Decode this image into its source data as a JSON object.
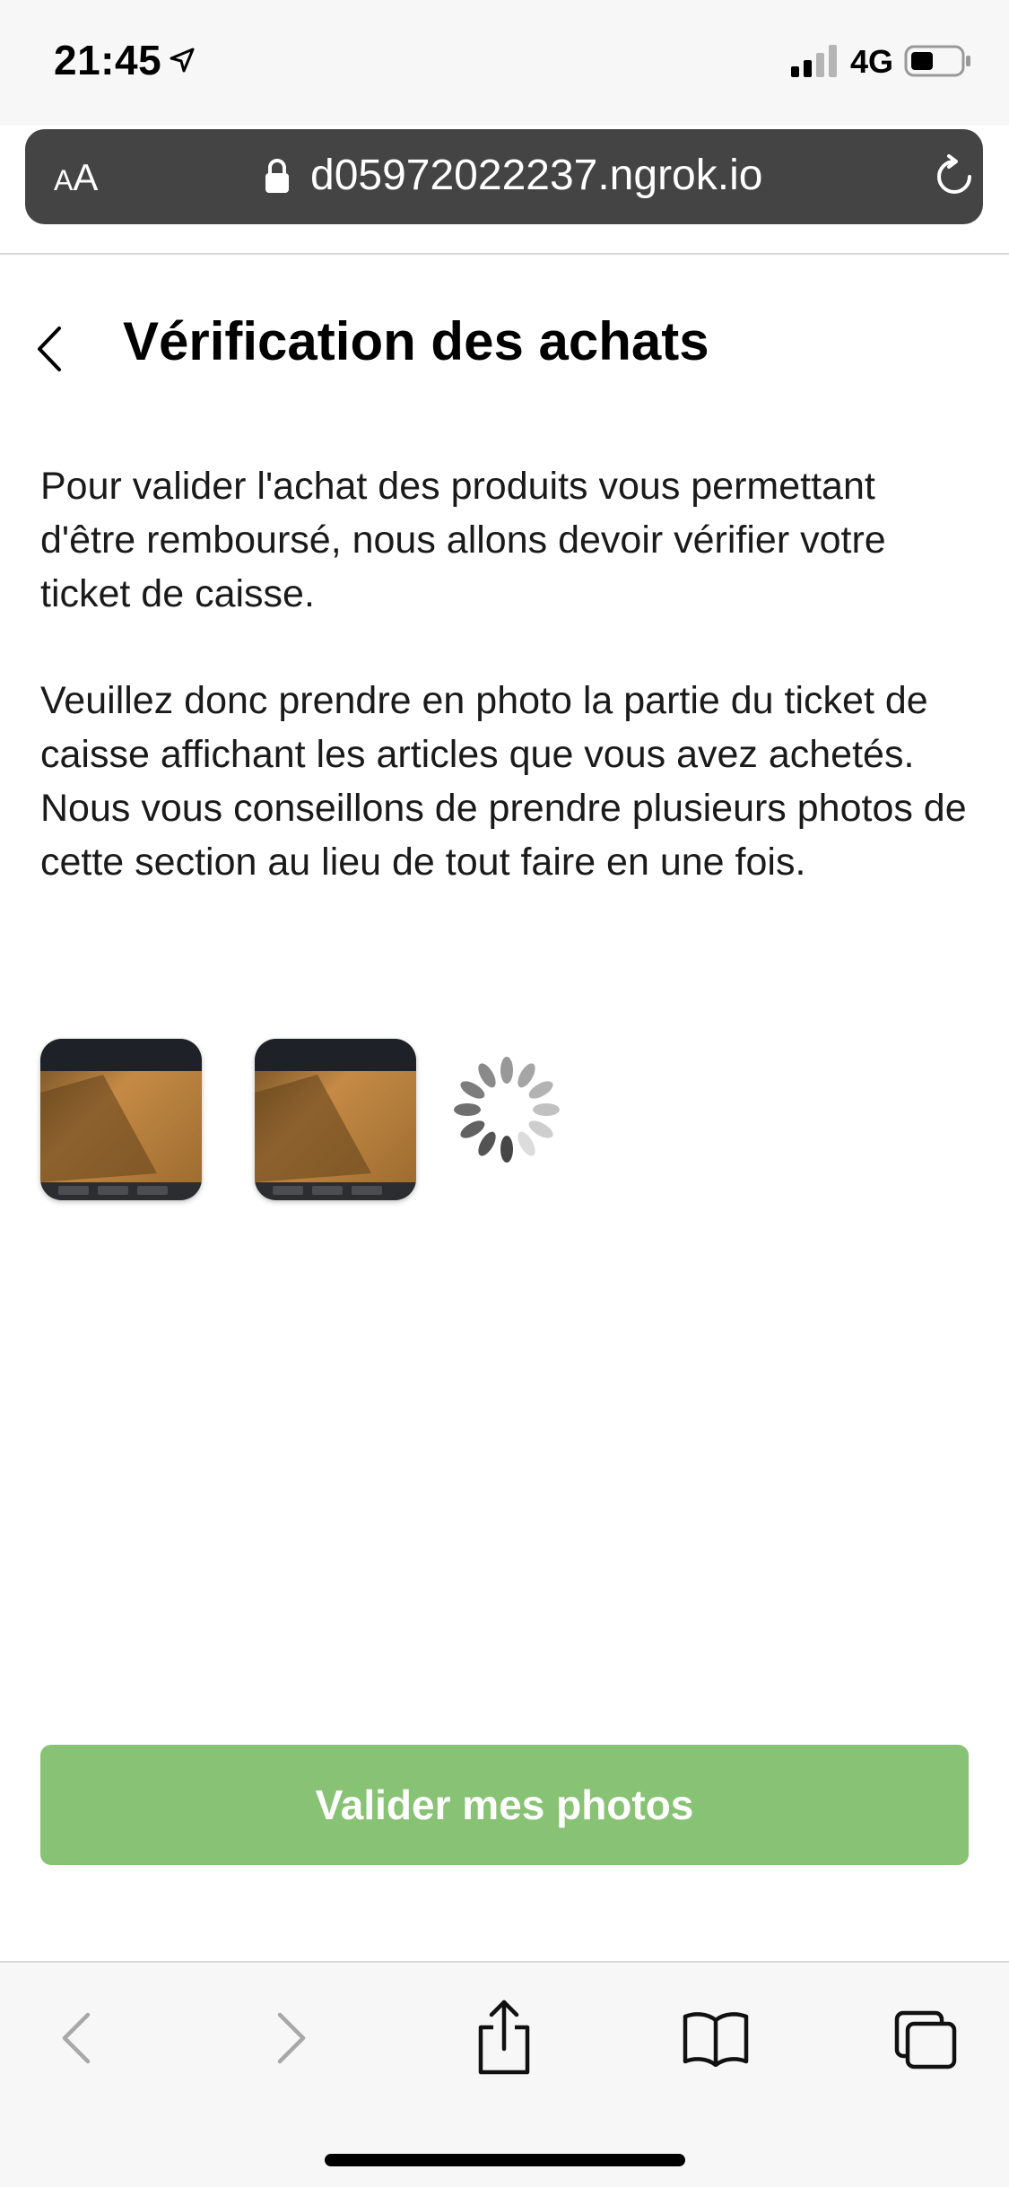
{
  "status_bar": {
    "time": "21:45",
    "network": "4G",
    "icons": [
      "location-arrow-icon",
      "signal-icon",
      "battery-icon"
    ]
  },
  "browser": {
    "text_size_small": "A",
    "text_size_big": "A",
    "url": "d05972022237.ngrok.io",
    "icons": [
      "lock-icon",
      "reload-icon"
    ],
    "toolbar_icons": [
      "back-icon",
      "forward-icon",
      "share-icon",
      "bookmarks-icon",
      "tabs-icon"
    ]
  },
  "page": {
    "title": "Vérification des achats",
    "paragraph_1": "Pour valider l'achat des produits vous permettant d'être remboursé, nous allons devoir vérifier votre ticket de caisse.",
    "paragraph_2": "Veuillez donc prendre en photo la partie du ticket de caisse affichant les articles que vous avez achetés. Nous vous conseillons de prendre plusieurs photos de cette section au lieu de tout faire en une fois.",
    "photos_count": 2,
    "uploading": true,
    "submit_label": "Valider mes photos"
  },
  "colors": {
    "accent_green": "#88c274",
    "address_bar": "#444444"
  }
}
